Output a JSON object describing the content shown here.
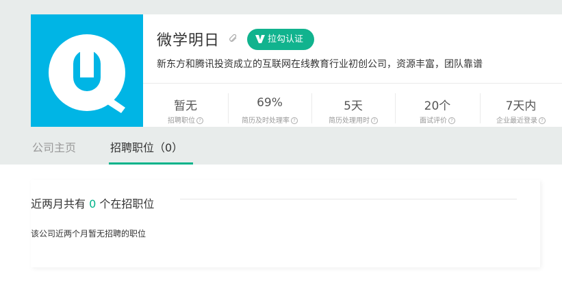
{
  "company": {
    "name": "微学明日",
    "verify_label": "拉勾认证",
    "description": "新东方和腾讯投资成立的互联网在线教育行业初创公司，资源丰富，团队靠谱",
    "brand_color": "#00b5e5",
    "accent_color": "#11b38e"
  },
  "stats": [
    {
      "value": "暂无",
      "label": "招聘职位"
    },
    {
      "value": "69%",
      "label": "简历及时处理率"
    },
    {
      "value": "5天",
      "label": "简历处理用时"
    },
    {
      "value": "20个",
      "label": "面试评价"
    },
    {
      "value": "7天内",
      "label": "企业最近登录"
    }
  ],
  "tabs": {
    "home": "公司主页",
    "jobs": "招聘职位（0）"
  },
  "jobs_section": {
    "title_prefix": "近两月共有",
    "count": "0",
    "title_suffix": "个在招职位",
    "empty_message": "该公司近两个月暂无招聘的职位"
  }
}
